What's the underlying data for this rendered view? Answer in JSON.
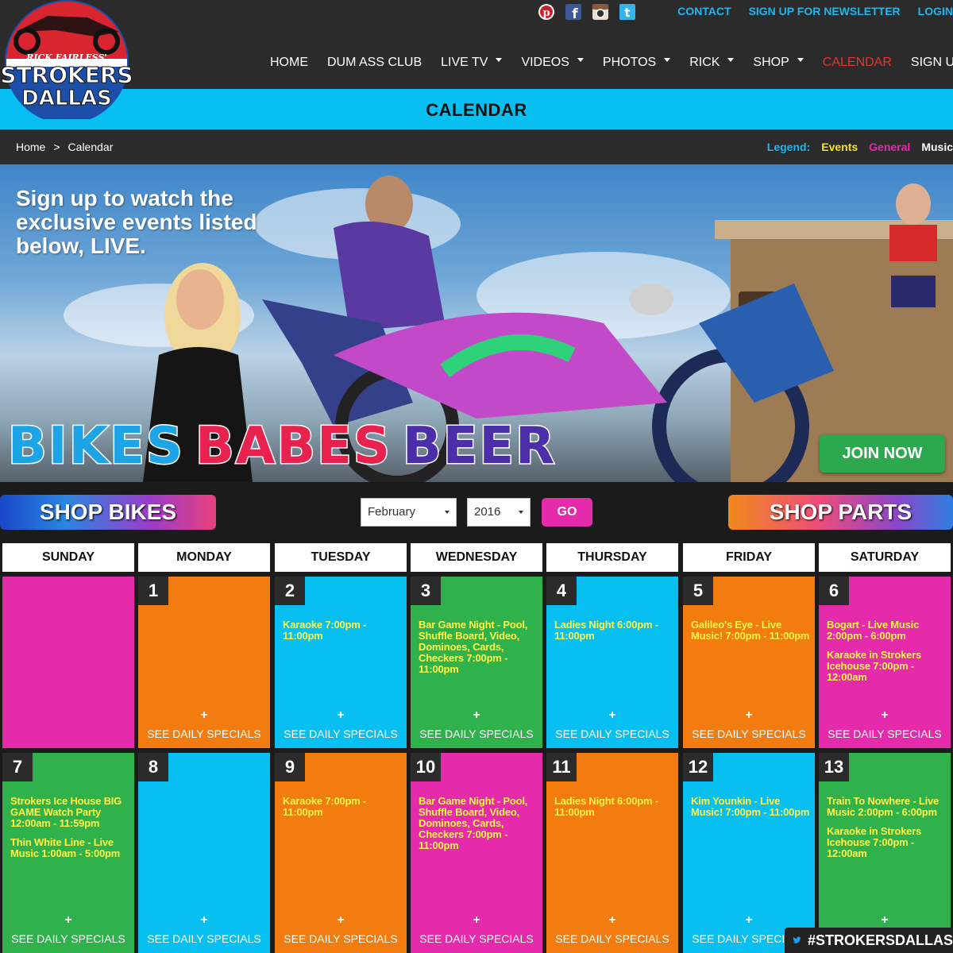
{
  "header": {
    "logo_text": [
      "RICK FAIRLESS'",
      "STROKERS",
      "DALLAS"
    ],
    "social_icons": [
      "pinterest-icon",
      "facebook-icon",
      "instagram-icon",
      "twitter-icon"
    ],
    "top_links": [
      "CONTACT",
      "SIGN UP FOR NEWSLETTER",
      "LOGIN"
    ],
    "nav": [
      {
        "label": "HOME",
        "dropdown": false
      },
      {
        "label": "DUM ASS CLUB",
        "dropdown": false
      },
      {
        "label": "LIVE TV",
        "dropdown": true
      },
      {
        "label": "VIDEOS",
        "dropdown": true
      },
      {
        "label": "PHOTOS",
        "dropdown": true
      },
      {
        "label": "RICK",
        "dropdown": true
      },
      {
        "label": "SHOP",
        "dropdown": true
      },
      {
        "label": "CALENDAR",
        "dropdown": false,
        "active": true
      },
      {
        "label": "SIGN UP",
        "dropdown": false
      }
    ]
  },
  "page_title": "CALENDAR",
  "breadcrumb": [
    "Home",
    ">",
    "Calendar"
  ],
  "legend": {
    "label": "Legend:",
    "items": [
      {
        "label": "Events",
        "color": "#f2e618"
      },
      {
        "label": "General",
        "color": "#e52aac"
      },
      {
        "label": "Music",
        "color": "#ffffff"
      }
    ]
  },
  "hero": {
    "headline": "Sign up to watch the exclusive events listed below, LIVE.",
    "tagline": [
      {
        "word": "BIKES",
        "color": "#1ca4e6"
      },
      {
        "word": "BABES",
        "color": "#e8224f"
      },
      {
        "word": "BEER",
        "color": "#4a2fa8"
      }
    ],
    "join_button": "JOIN NOW"
  },
  "controls": {
    "shop_bikes": "SHOP BIKES",
    "shop_parts": "SHOP PARTS",
    "month_value": "February",
    "year_value": "2016",
    "go_button": "GO"
  },
  "calendar": {
    "weekdays": [
      "SUNDAY",
      "MONDAY",
      "TUESDAY",
      "WEDNESDAY",
      "THURSDAY",
      "FRIDAY",
      "SATURDAY"
    ],
    "see_specials": "SEE DAILY SPECIALS",
    "plus": "+",
    "weeks": [
      [
        {
          "day": "",
          "color": "#e52aac",
          "events": [],
          "specials": false
        },
        {
          "day": "1",
          "color": "#f27c0f",
          "events": [],
          "specials": true
        },
        {
          "day": "2",
          "color": "#08bff2",
          "events": [
            "Karaoke 7:00pm - 11:00pm"
          ],
          "specials": true
        },
        {
          "day": "3",
          "color": "#2fb24c",
          "events": [
            "Bar Game Night - Pool, Shuffle Board, Video, Dominoes, Cards, Checkers 7:00pm - 11:00pm"
          ],
          "specials": true
        },
        {
          "day": "4",
          "color": "#08bff2",
          "events": [
            "Ladies Night 6:00pm - 11:00pm"
          ],
          "specials": true
        },
        {
          "day": "5",
          "color": "#f27c0f",
          "events": [
            "Galileo's Eye - Live Music! 7:00pm - 11:00pm"
          ],
          "specials": true
        },
        {
          "day": "6",
          "color": "#e52aac",
          "events": [
            "Bogart - Live Music 2:00pm - 6:00pm",
            "Karaoke in Strokers Icehouse 7:00pm - 12:00am"
          ],
          "specials": true
        }
      ],
      [
        {
          "day": "7",
          "color": "#2fb24c",
          "events": [
            "Strokers Ice House BIG GAME Watch Party 12:00am - 11:59pm",
            "Thin White Line - Live Music 1:00am - 5:00pm"
          ],
          "specials": true
        },
        {
          "day": "8",
          "color": "#08bff2",
          "events": [],
          "specials": true
        },
        {
          "day": "9",
          "color": "#f27c0f",
          "events": [
            "Karaoke 7:00pm - 11:00pm"
          ],
          "specials": true
        },
        {
          "day": "10",
          "color": "#e52aac",
          "events": [
            "Bar Game Night - Pool, Shuffle Board, Video, Dominoes, Cards, Checkers 7:00pm - 11:00pm"
          ],
          "specials": true
        },
        {
          "day": "11",
          "color": "#f27c0f",
          "events": [
            "Ladies Night 6:00pm - 11:00pm"
          ],
          "specials": true
        },
        {
          "day": "12",
          "color": "#08bff2",
          "events": [
            "Kim Younkin - Live Music! 7:00pm - 11:00pm"
          ],
          "specials": true
        },
        {
          "day": "13",
          "color": "#2fb24c",
          "events": [
            "Train To Nowhere - Live Music 2:00pm - 6:00pm",
            "Karaoke in Strokers Icehouse 7:00pm - 12:00am"
          ],
          "specials": true
        }
      ]
    ]
  },
  "twitter_hashtag": "#STROKERSDALLAS"
}
